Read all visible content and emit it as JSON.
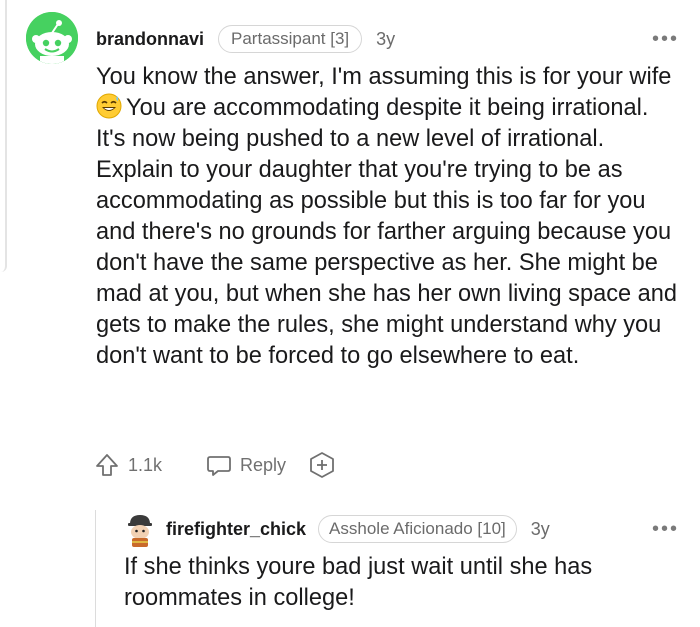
{
  "comment": {
    "username": "brandonnavi",
    "flair": "Partassipant [3]",
    "age": "3y",
    "more_label": "•••",
    "text_before_emoji": "You know the answer, I'm assuming this is for your wife ",
    "emoji": "grinning-sweat-emoji",
    "text_after_emoji": "You are accommodating despite it being irrational. It's now being pushed to a new level of irrational. Explain to your daughter that you're trying to be as accommodating as possible but this is too far for you and there's no grounds for farther arguing because you don't have the same perspective as her. She might be mad at you, but when she has her own living space and gets to make the rules, she might understand why you don't want to be forced to go elsewhere to eat.",
    "upvotes": "1.1k",
    "reply_label": "Reply",
    "icons": {
      "upvote": "upvote-arrow-icon",
      "reply": "reply-bubble-icon",
      "award": "award-plus-icon"
    }
  },
  "reply": {
    "username": "firefighter_chick",
    "flair": "Asshole Aficionado [10]",
    "age": "3y",
    "more_label": "•••",
    "text": "If she thinks youre bad just wait until she has roommates in college!"
  },
  "colors": {
    "avatar_green": "#46d160",
    "muted": "#707070",
    "text": "#1a1a1b"
  }
}
